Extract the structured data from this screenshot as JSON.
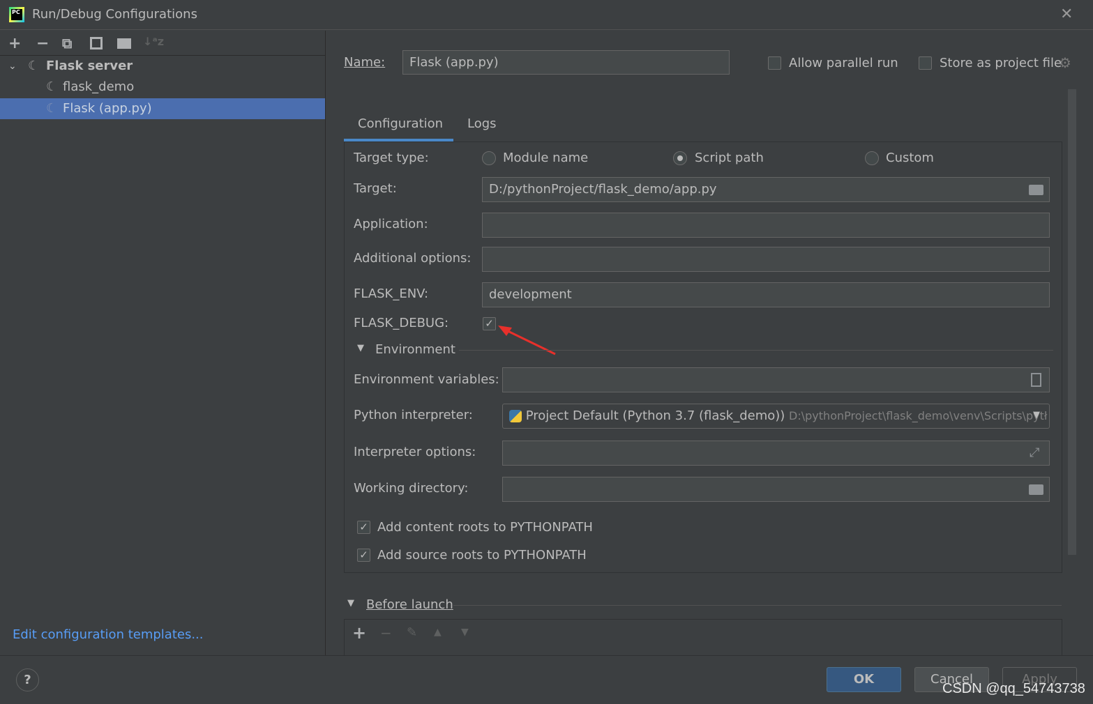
{
  "window": {
    "title": "Run/Debug Configurations",
    "close": "✕"
  },
  "toolbar": {
    "add": "+",
    "remove": "−",
    "copy": "⧉",
    "save": "💾",
    "folder": "📁",
    "sort": "↓ᵃz"
  },
  "tree": {
    "group": "Flask server",
    "items": [
      "flask_demo",
      "Flask (app.py)"
    ]
  },
  "edit_templates": "Edit configuration templates...",
  "name": {
    "label": "Name:",
    "value": "Flask (app.py)"
  },
  "allow_parallel": {
    "label": "Allow parallel run",
    "checked": false
  },
  "store_project": {
    "label": "Store as project file",
    "checked": false
  },
  "tabs": [
    "Configuration",
    "Logs"
  ],
  "target_type": {
    "label": "Target type:",
    "options": [
      "Module name",
      "Script path",
      "Custom"
    ],
    "selected": "Script path"
  },
  "target": {
    "label": "Target:",
    "value": "D:/pythonProject/flask_demo/app.py"
  },
  "application": {
    "label": "Application:",
    "value": ""
  },
  "additional_options": {
    "label": "Additional options:",
    "value": ""
  },
  "flask_env": {
    "label": "FLASK_ENV:",
    "value": "development"
  },
  "flask_debug": {
    "label": "FLASK_DEBUG:",
    "checked": true
  },
  "environment": {
    "section": "Environment",
    "env_vars_label": "Environment variables:",
    "interpreter_label": "Python interpreter:",
    "interpreter_value": "Project Default (Python 3.7 (flask_demo))",
    "interpreter_path": "D:\\pythonProject\\flask_demo\\venv\\Scripts\\pytł",
    "interp_options_label": "Interpreter options:",
    "working_dir_label": "Working directory:"
  },
  "content_roots": {
    "label": "Add content roots to PYTHONPATH",
    "checked": true
  },
  "source_roots": {
    "label": "Add source roots to PYTHONPATH",
    "checked": true
  },
  "before_launch": {
    "label": "Before launch"
  },
  "buttons": {
    "ok": "OK",
    "cancel": "Cancel",
    "apply": "Apply",
    "help": "?"
  },
  "watermark": "CSDN @qq_54743738",
  "colors": {
    "selection": "#4b6eaf",
    "accent": "#4a88c7",
    "ok": "#365880",
    "link": "#589df6",
    "arrow": "#e8302b"
  }
}
